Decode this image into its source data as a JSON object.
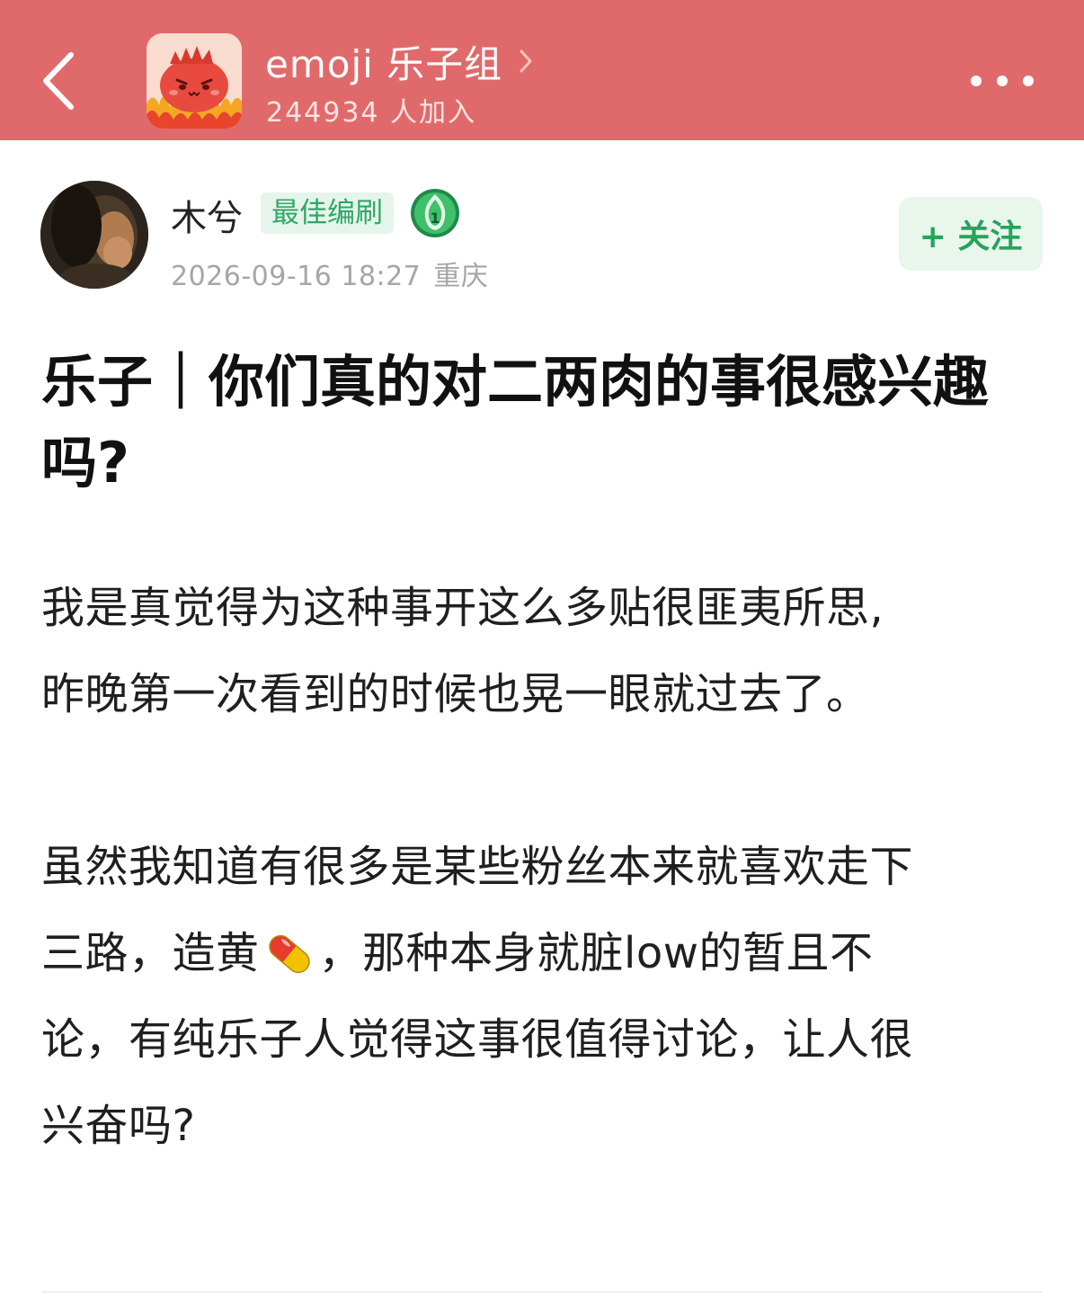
{
  "header": {
    "group_name": "emoji 乐子组",
    "members": "244934 人加入",
    "background_color": "#e06a6b",
    "icons": {
      "back": "back-arrow-icon",
      "chevron": "chevron-right-icon",
      "more": "more-dots-icon"
    }
  },
  "author": {
    "name": "木兮",
    "badge": "最佳编刷",
    "level": "1",
    "timestamp": "2026-09-16 18:27",
    "location": "重庆",
    "follow_label": "+ 关注"
  },
  "post": {
    "title": "乐子｜你们真的对二两肉的事很感兴趣吗?",
    "para1_line1": "我是真觉得为这种事开这么多贴很匪夷所思,",
    "para1_line2": "昨晚第一次看到的时候也晃一眼就过去了。",
    "para2_line1": "虽然我知道有很多是某些粉丝本来就喜欢走下",
    "para2_line2_a": "三路，造黄",
    "para2_emoji": "pill-emoji",
    "para2_line2_b": "，那种本身就脏low的暂且不",
    "para2_line3": "论，有纯乐子人觉得这事很值得讨论，让人很",
    "para2_line4": "兴奋吗?"
  }
}
